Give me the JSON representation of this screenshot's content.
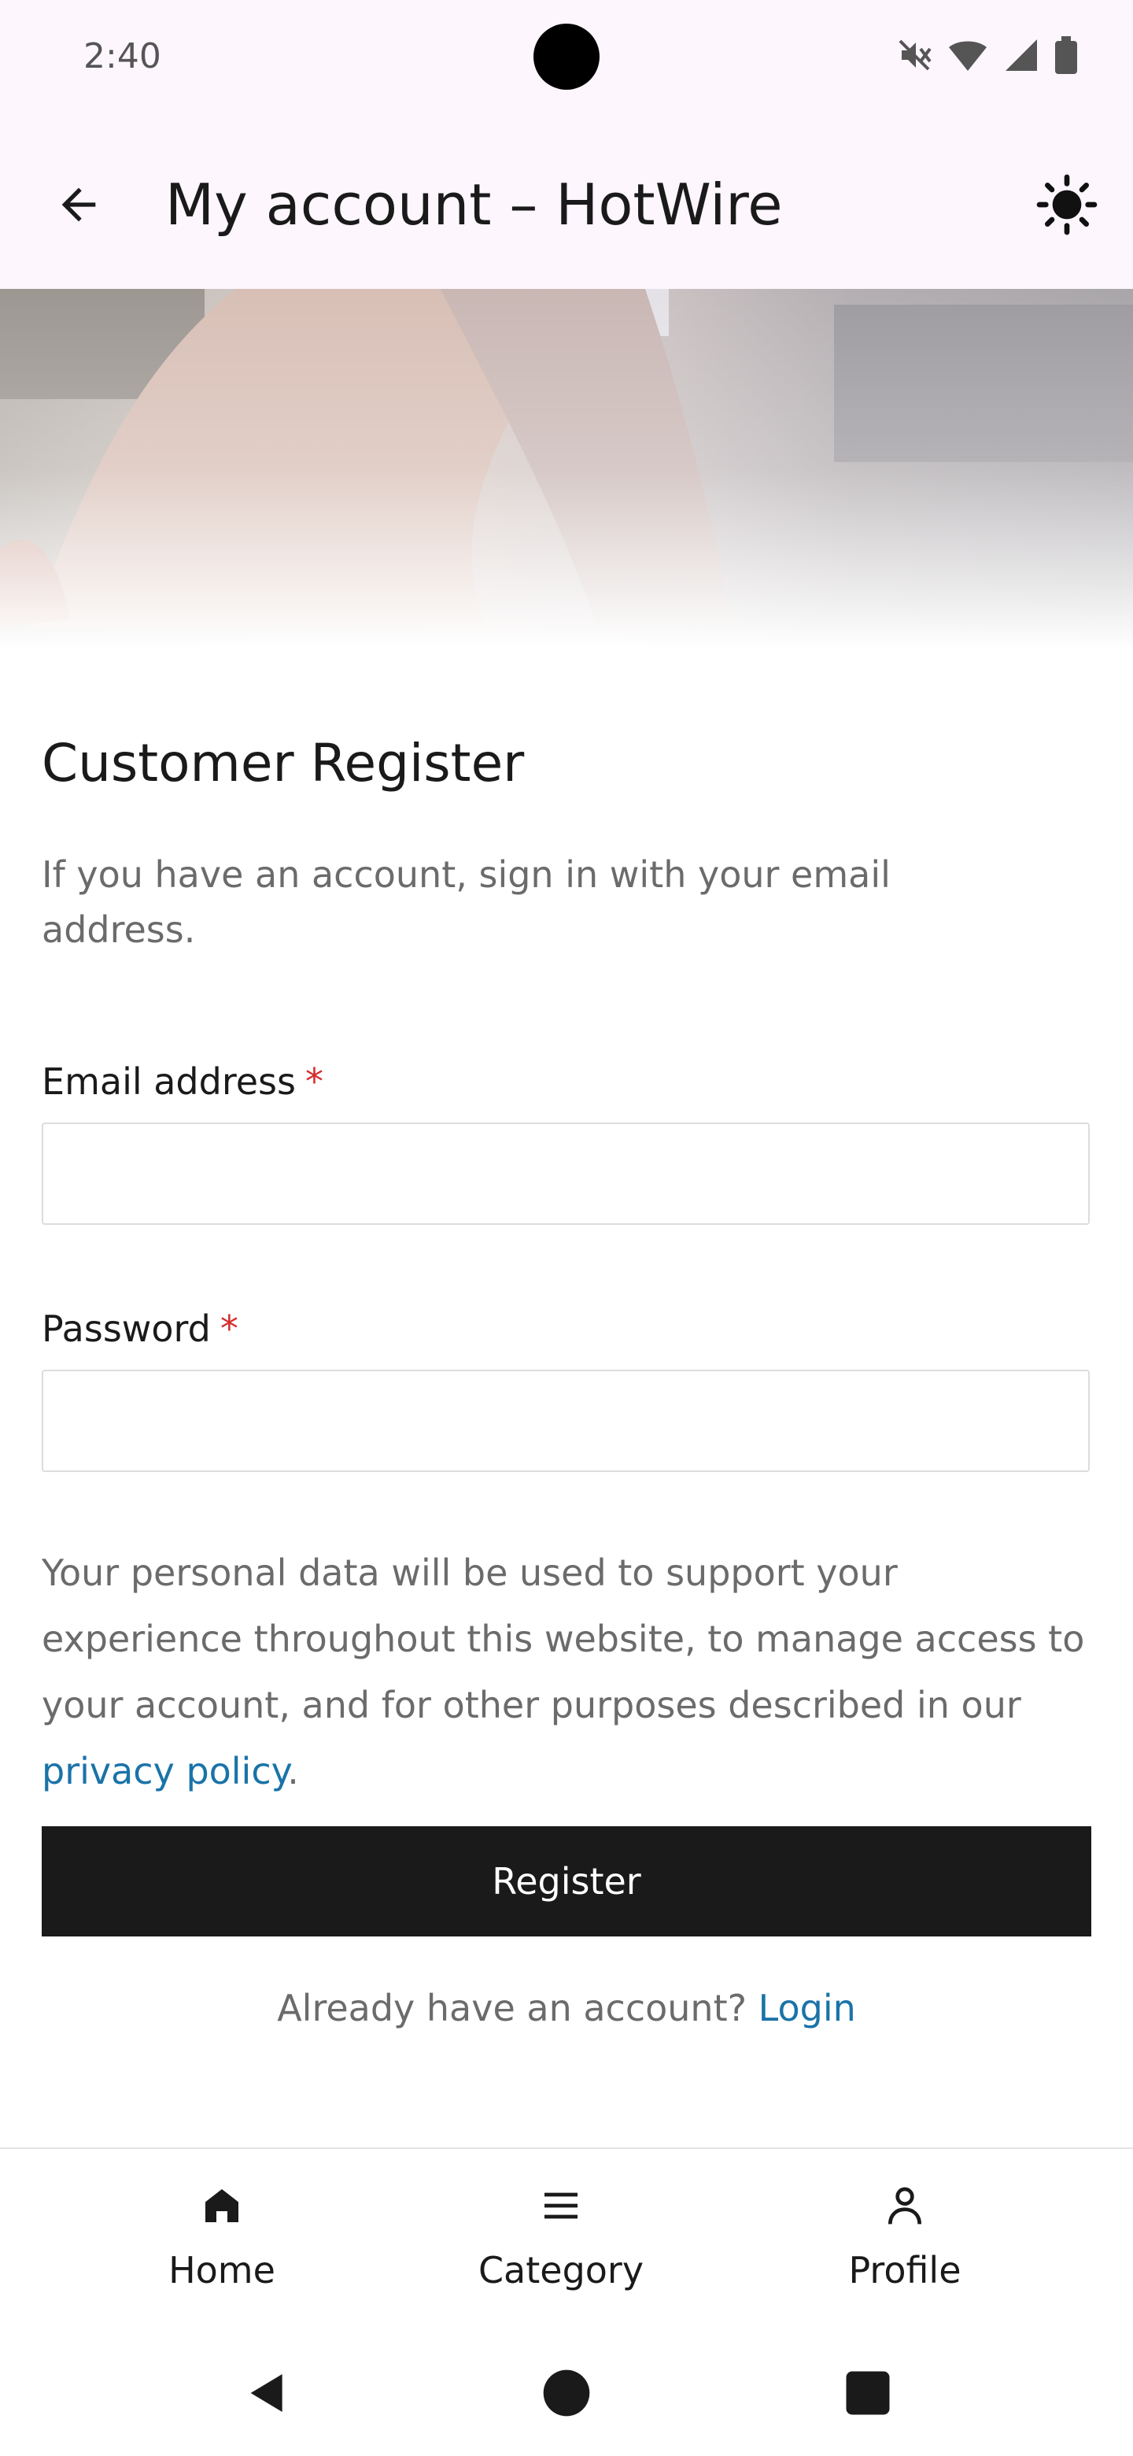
{
  "status_bar": {
    "time": "2:40"
  },
  "app_bar": {
    "title": "My account – HotWire"
  },
  "form": {
    "heading": "Customer Register",
    "subtext": "If you have an account, sign in with your email address.",
    "email_label": "Email address",
    "password_label": "Password",
    "required_mark": "*",
    "email_value": "",
    "password_value": "",
    "policy_text": "Your personal data will be used to support your experience throughout this website, to manage access to your account, and for other purposes described in our ",
    "policy_link": "privacy policy",
    "policy_end": ".",
    "register_label": "Register",
    "already_text": "Already have an account? ",
    "login_link": "Login"
  },
  "bottom_nav": {
    "items": [
      {
        "label": "Home",
        "icon": "home-icon"
      },
      {
        "label": "Category",
        "icon": "menu-icon"
      },
      {
        "label": "Profile",
        "icon": "person-icon"
      }
    ]
  },
  "colors": {
    "app_bar_bg": "#fdf6fd",
    "primary_button": "#1a1a1a",
    "link": "#1a73a8",
    "required": "#d32f2f"
  }
}
